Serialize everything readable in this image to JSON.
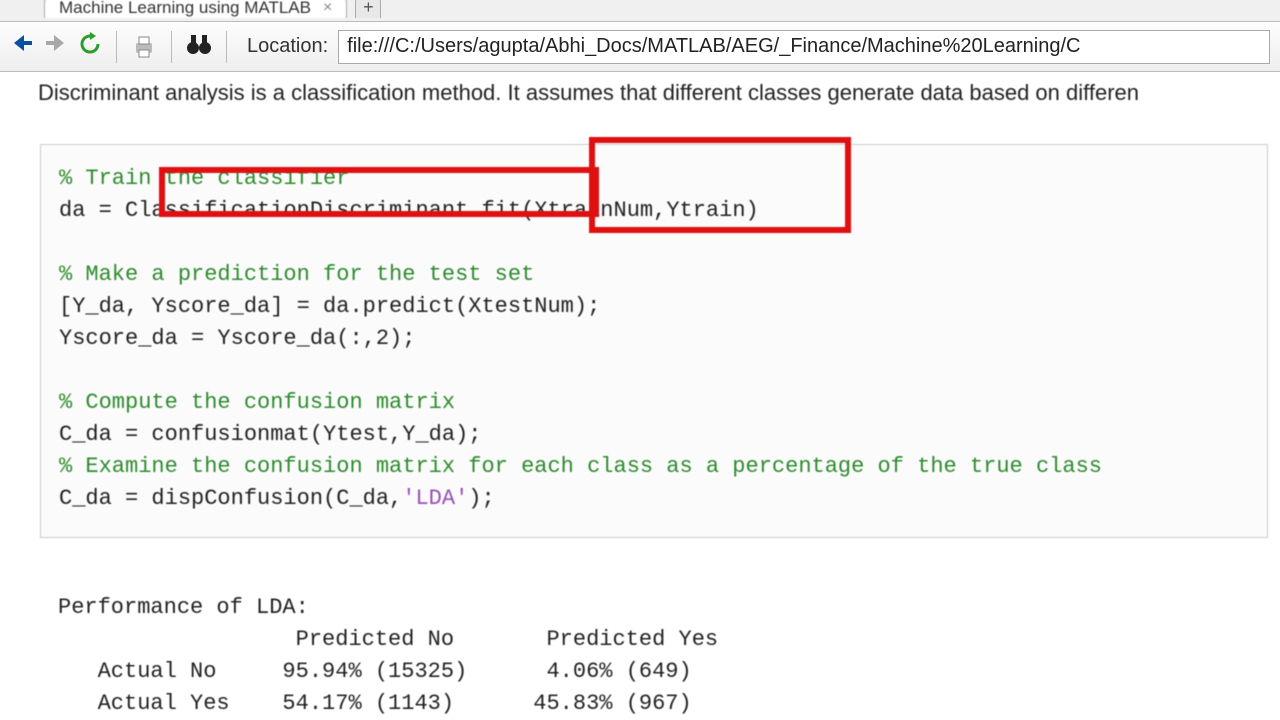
{
  "tab": {
    "title": "Machine Learning using MATLAB"
  },
  "toolbar": {
    "location_label": "Location:",
    "location_value": "file:///C:/Users/agupta/Abhi_Docs/MATLAB/AEG/_Finance/Machine%20Learning/C"
  },
  "intro": "Discriminant analysis is a classification method. It assumes that different classes generate data based on differen",
  "code": {
    "c1": "% Train the classifier",
    "l1a": "da = ",
    "l1b": "ClassificationDiscriminant.fit",
    "l1c": "(XtrainNum,Ytrain)",
    "c2": "% Make a prediction for the test set",
    "l2": "[Y_da, Yscore_da] = da.predict(XtestNum);",
    "l3": "Yscore_da = Yscore_da(:,2);",
    "c3": "% Compute the confusion matrix",
    "l4": "C_da = confusionmat(Ytest,Y_da);",
    "c4": "% Examine the confusion matrix for each class as a percentage of the true class",
    "l5a": "C_da = dispConfusion(C_da,",
    "l5b": "'LDA'",
    "l5c": ");"
  },
  "output": {
    "title": "Performance of LDA:",
    "header": "                  Predicted No       Predicted Yes",
    "row1": "   Actual No     95.94% (15325)      4.06% (649)",
    "row2": "   Actual Yes    54.17% (1143)      45.83% (967)"
  }
}
